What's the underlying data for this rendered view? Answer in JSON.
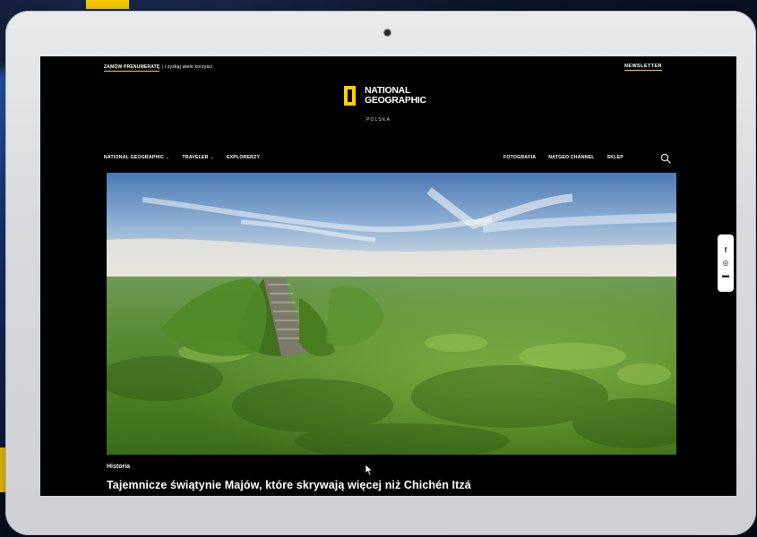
{
  "topbar": {
    "subscribe_link": "ZAMÓW PRENUMERATĘ",
    "subscribe_tail": "i zyskaj wiele korzyści",
    "newsletter": "NEWSLETTER"
  },
  "logo": {
    "line1": "NATIONAL",
    "line2": "GEOGRAPHIC",
    "sub": "POLSKA",
    "accent": "#ffd100"
  },
  "nav": {
    "left": [
      {
        "label": "NATIONAL GEOGRAPHIC",
        "dropdown": true
      },
      {
        "label": "TRAVELER",
        "dropdown": true
      },
      {
        "label": "EXPLORERZY",
        "dropdown": false
      }
    ],
    "right": [
      {
        "label": "FOTOGRAFIA"
      },
      {
        "label": "NATGEO CHANNEL"
      },
      {
        "label": "SKLEP"
      }
    ],
    "search_icon": "search-icon"
  },
  "article": {
    "category": "Historia",
    "title": "Tajemnicze świątynie Majów, które skrywają więcej niż Chichén Itzá"
  },
  "social": {
    "facebook_glyph": "f",
    "instagram_glyph": "◎",
    "youtube_glyph": "▬"
  },
  "colors": {
    "accent_yellow": "#ffd100",
    "page_background": "#000000"
  }
}
